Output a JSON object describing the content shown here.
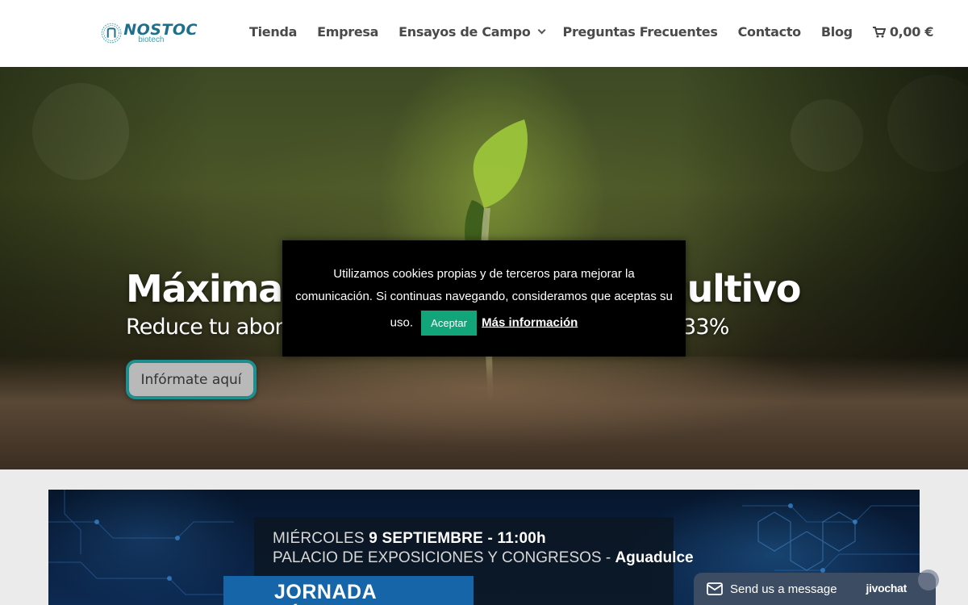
{
  "header": {
    "logo": {
      "word": "NOSTOC",
      "sub": "biotech"
    },
    "nav": [
      {
        "label": "Tienda"
      },
      {
        "label": "Empresa"
      },
      {
        "label": "Ensayos de Campo",
        "has_dropdown": true
      },
      {
        "label": "Preguntas Frecuentes"
      },
      {
        "label": "Contacto"
      },
      {
        "label": "Blog"
      }
    ],
    "cart": {
      "amount": "0,00 €",
      "icon": "cart-icon"
    }
  },
  "hero": {
    "title": "Máxima rentabilidad en tu cultivo",
    "subtitle_start": "Reduce tu abona",
    "subtitle_end": "33%",
    "button_label": "Infórmate aquí"
  },
  "cookie": {
    "text_line1": "Utilizamos cookies propias y de terceros para mejorar la",
    "text_line2": "comunicación. Si continuas navegando, consideramos que aceptas su",
    "text_line3": "uso.",
    "accept_label": "Aceptar",
    "more_label": "Más información",
    "accent_color": "#13a57a"
  },
  "banner": {
    "line1_prefix": "MIÉRCOLES ",
    "line1_date": "9 SEPTIEMBRE - 11:00h",
    "line2_prefix": "PALACIO DE EXPOSICIONES Y CONGRESOS - ",
    "line2_place": "Aguadulce",
    "tag": "JORNADA TÉCNICA"
  },
  "chat": {
    "label": "Send us a message",
    "brand": "jivochat",
    "icon": "envelope-icon"
  }
}
